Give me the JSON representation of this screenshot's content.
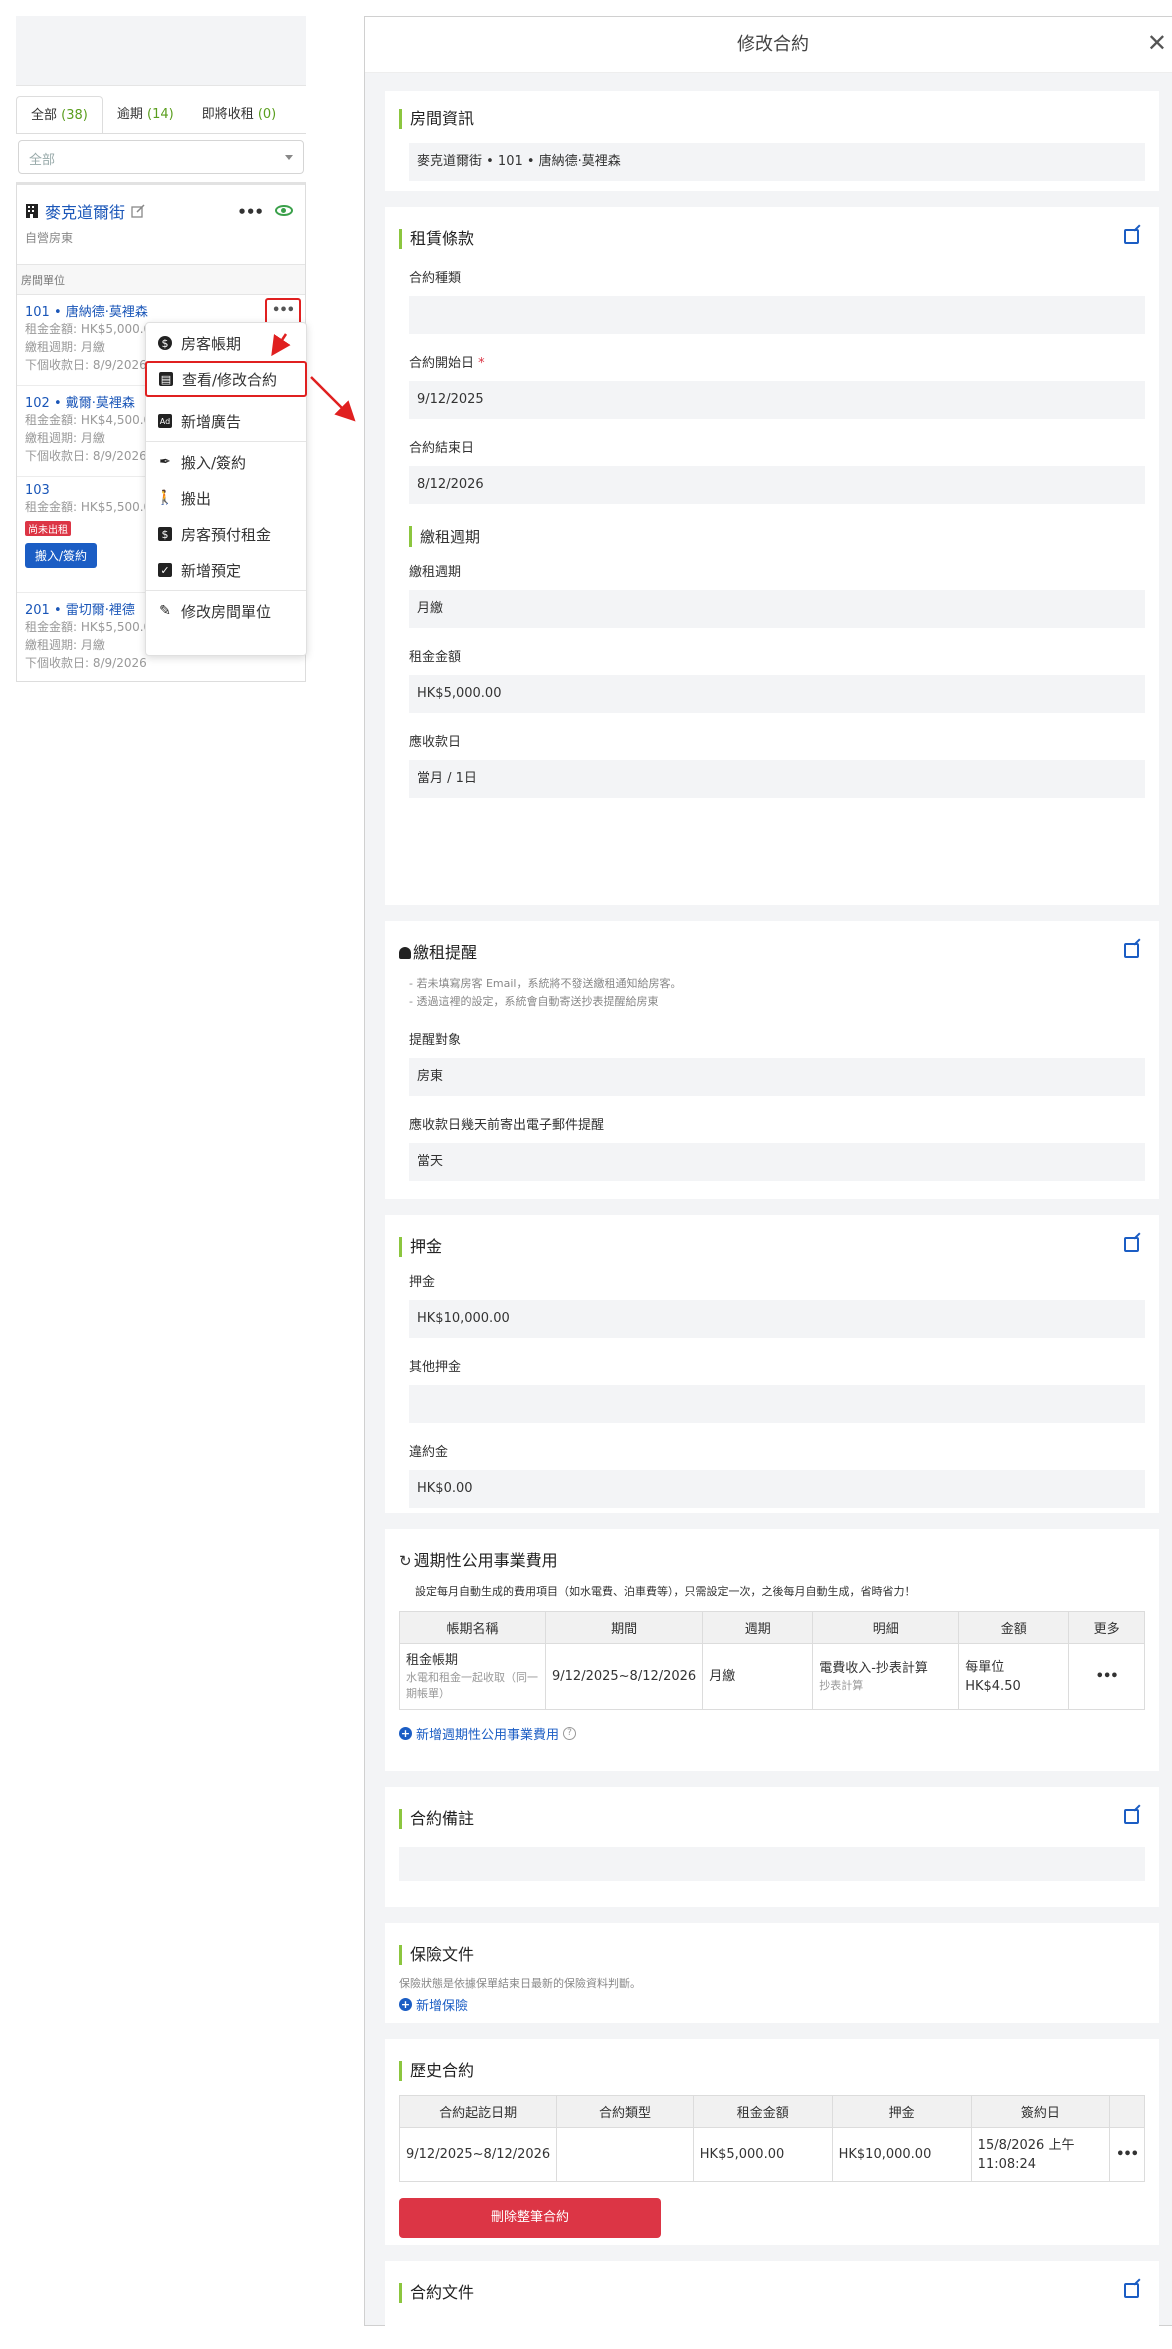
{
  "left": {
    "tabs": [
      {
        "label": "全部",
        "count": "(38)"
      },
      {
        "label": "逾期",
        "count": "(14)"
      },
      {
        "label": "即將收租",
        "count": "(0)"
      }
    ],
    "filter": "全部",
    "property": {
      "name": "麥克道爾街",
      "type": "自營房東",
      "units_label": "房間單位"
    },
    "units": [
      {
        "name": "101 • 唐納德·莫裡森",
        "rent": "租金金額: HK$5,000.00",
        "cycle": "繳租週期: 月繳",
        "next": "下個收款日: 8/9/2026"
      },
      {
        "name": "102 • 戴爾·莫裡森",
        "rent": "租金金額: HK$4,500.00",
        "cycle": "繳租週期: 月繳",
        "next": "下個收款日: 8/9/2026"
      },
      {
        "name": "103",
        "rent": "租金金額: HK$5,500.00",
        "vacant": "尚未出租",
        "checkin": "搬入/簽約"
      },
      {
        "name": "201 • 雷切爾·裡德",
        "rent": "租金金額: HK$5,500.00",
        "cycle": "繳租週期: 月繳",
        "next": "下個收款日: 8/9/2026"
      }
    ],
    "menu": [
      {
        "label": "房客帳期",
        "icon": "dollar-icon"
      },
      {
        "label": "查看/修改合約",
        "icon": "document-icon"
      },
      {
        "label": "新增廣告",
        "icon": "ad-icon"
      },
      {
        "label": "搬入/簽約",
        "icon": "pen-icon"
      },
      {
        "label": "搬出",
        "icon": "walking-icon"
      },
      {
        "label": "房客預付租金",
        "icon": "prepay-icon"
      },
      {
        "label": "新增預定",
        "icon": "calendar-check-icon"
      },
      {
        "label": "修改房間單位",
        "icon": "edit-icon"
      }
    ]
  },
  "modal": {
    "title": "修改合約",
    "room_info": {
      "title": "房間資訊",
      "value": "麥克道爾街 • 101 • 唐納德·莫裡森"
    },
    "lease": {
      "title": "租賃條款",
      "contract_type_label": "合約種類",
      "contract_type": "",
      "start_label": "合約開始日",
      "required": "*",
      "start": "9/12/2025",
      "end_label": "合約結束日",
      "end": "8/12/2026",
      "cycle_title": "繳租週期",
      "cycle_label": "繳租週期",
      "cycle": "月繳",
      "rent_label": "租金金額",
      "rent": "HK$5,000.00",
      "due_label": "應收款日",
      "due": "當月 / 1日"
    },
    "reminder": {
      "title": "繳租提醒",
      "hint1": "- 若未填寫房客 Email，系統將不發送繳租通知給房客。",
      "hint2": "- 透過這裡的設定，系統會自動寄送抄表提醒給房東",
      "target_label": "提醒對象",
      "target": "房東",
      "days_label": "應收款日幾天前寄出電子郵件提醒",
      "days": "當天"
    },
    "deposit": {
      "title": "押金",
      "deposit_label": "押金",
      "deposit": "HK$10,000.00",
      "other_label": "其他押金",
      "other": "",
      "penalty_label": "違約金",
      "penalty": "HK$0.00"
    },
    "utilities": {
      "title": "週期性公用事業費用",
      "desc": "設定每月自動生成的費用項目（如水電費、泊車費等），只需設定一次，之後每月自動生成，省時省力！",
      "headers": [
        "帳期名稱",
        "期間",
        "週期",
        "明細",
        "金額",
        "更多"
      ],
      "row": {
        "name": "租金帳期",
        "name_sub": "水電和租金一起收取（同一期帳單）",
        "period": "9/12/2025~8/12/2026",
        "cycle": "月繳",
        "detail": "電費收入-抄表計算",
        "detail_sub": "抄表計算",
        "amount": "每單位 HK$4.50",
        "more": "•••"
      },
      "add": "新增週期性公用事業費用"
    },
    "notes": {
      "title": "合約備註",
      "value": ""
    },
    "insurance": {
      "title": "保險文件",
      "hint": "保險狀態是依據保單結束日最新的保險資料判斷。",
      "add": "新增保險"
    },
    "history": {
      "title": "歷史合約",
      "headers": [
        "合約起訖日期",
        "合約類型",
        "租金金額",
        "押金",
        "簽約日",
        ""
      ],
      "row": {
        "dates": "9/12/2025~8/12/2026",
        "type": "",
        "rent": "HK$5,000.00",
        "deposit": "HK$10,000.00",
        "signed": "15/8/2026 上午11:08:24",
        "more": "•••"
      },
      "delete": "刪除整筆合約"
    },
    "documents": {
      "title": "合約文件"
    }
  },
  "colors": {
    "accent_green": "#8cc63f",
    "link_blue": "#1b5dc4",
    "danger_red": "#dc3545",
    "highlight_red": "#e02020"
  }
}
